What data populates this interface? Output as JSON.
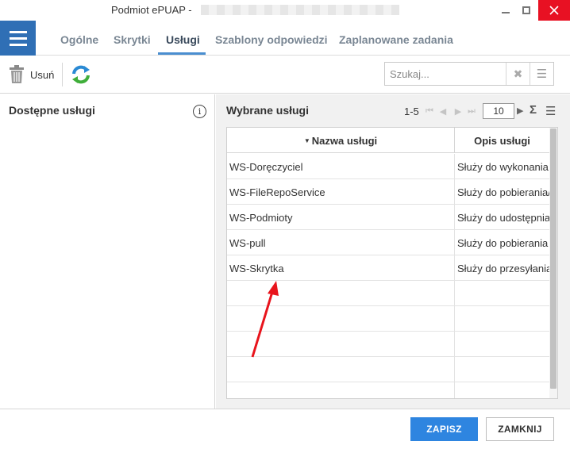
{
  "window": {
    "title": "Podmiot ePUAP -"
  },
  "tabs": [
    {
      "label": "Ogólne",
      "active": false
    },
    {
      "label": "Skrytki",
      "active": false
    },
    {
      "label": "Usługi",
      "active": true
    },
    {
      "label": "Szablony odpowiedzi",
      "active": false
    },
    {
      "label": "Zaplanowane zadania",
      "active": false
    }
  ],
  "toolbar": {
    "delete_label": "Usuń",
    "delete_icon": "trash-icon",
    "refresh_icon": "refresh-icon",
    "search_placeholder": "Szukaj...",
    "search_value": ""
  },
  "left_panel": {
    "title": "Dostępne usługi",
    "info_glyph": "i"
  },
  "right_panel": {
    "title": "Wybrane usługi",
    "pager": {
      "range": "1-5",
      "page_size": "10",
      "sum_glyph": "Σ"
    },
    "columns": [
      "Nazwa usługi",
      "Opis usługi"
    ],
    "sort_column": "Nazwa usługi",
    "rows": [
      {
        "name": "WS-Doręczyciel",
        "desc": "Służy do wykonania"
      },
      {
        "name": "WS-FileRepoService",
        "desc": "Służy do pobierania/"
      },
      {
        "name": "WS-Podmioty",
        "desc": "Służy do udostępnia"
      },
      {
        "name": "WS-pull",
        "desc": "Służy do pobierania d"
      },
      {
        "name": "WS-Skrytka",
        "desc": "Służy do przesyłania"
      }
    ],
    "empty_rows": 5
  },
  "footer": {
    "save_label": "ZAPISZ",
    "close_label": "ZAMKNIJ"
  },
  "colors": {
    "accent": "#2f6fb5",
    "save_button": "#2e85e0",
    "close_button_window": "#e81123",
    "annotation_arrow": "#e8141c"
  }
}
